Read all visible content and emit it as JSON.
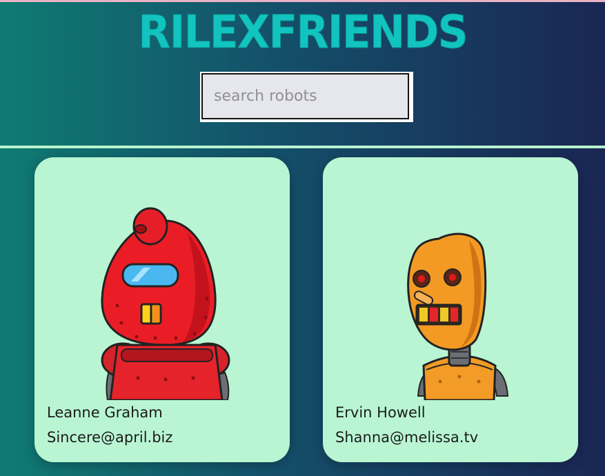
{
  "app": {
    "title": "RILEXFRIENDS"
  },
  "search": {
    "placeholder": "search robots",
    "value": ""
  },
  "colors": {
    "title": "#12c4c0",
    "card_background": "#b9f5d3",
    "divider": "#b9f3cf"
  },
  "robots": [
    {
      "name": "Leanne Graham",
      "email": "Sincere@april.biz",
      "image": "red-robot-image"
    },
    {
      "name": "Ervin Howell",
      "email": "Shanna@melissa.tv",
      "image": "orange-robot-image"
    }
  ]
}
